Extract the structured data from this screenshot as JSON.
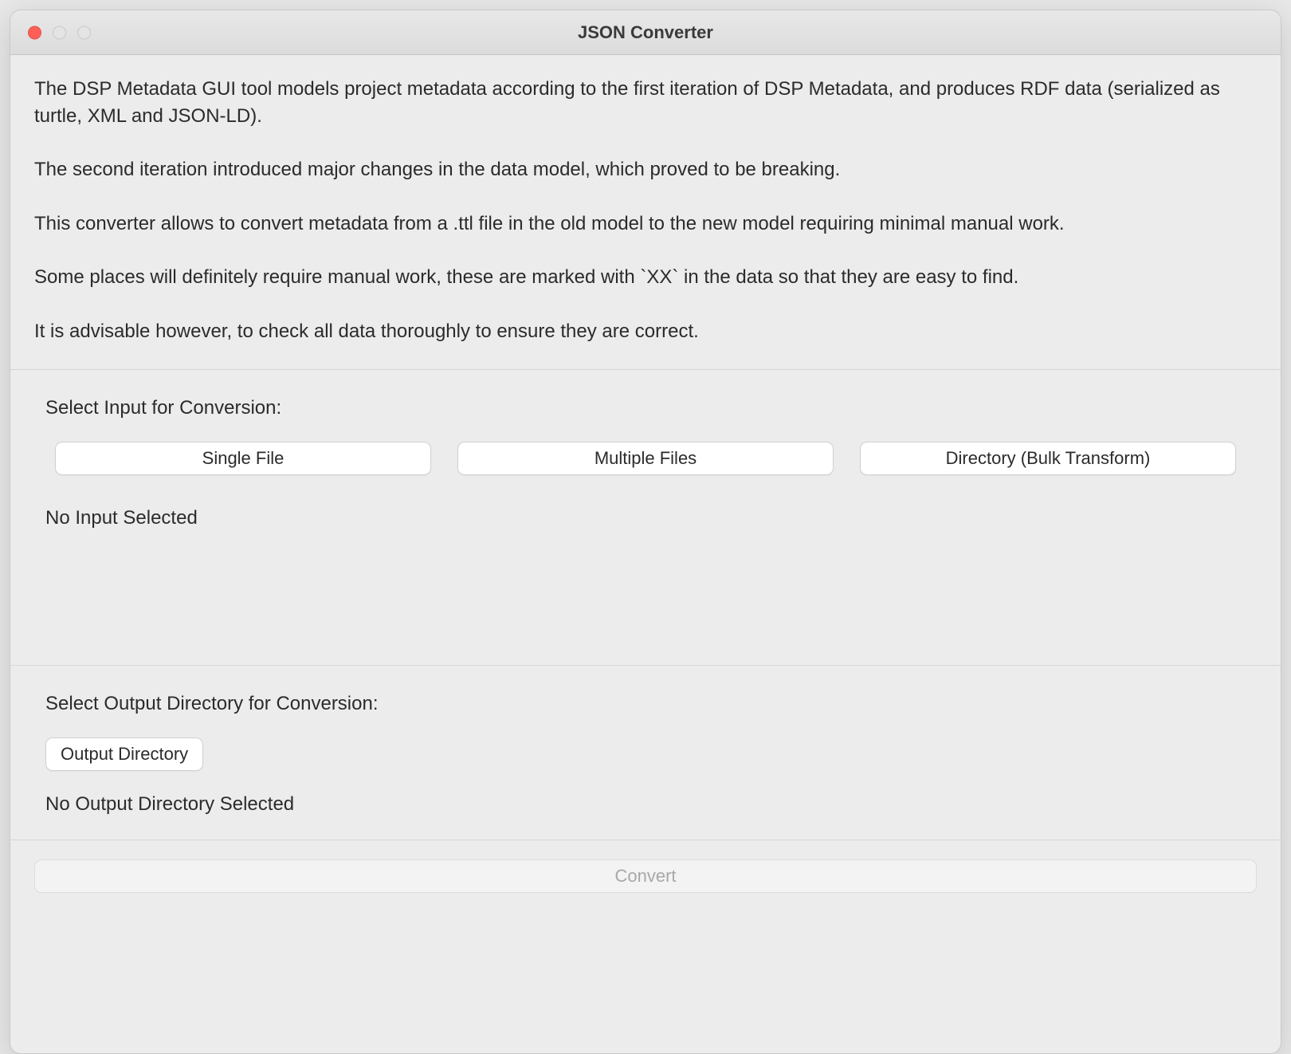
{
  "window": {
    "title": "JSON Converter"
  },
  "description": {
    "p1": "The DSP Metadata GUI tool models project metadata according to the first iteration of DSP Metadata, and produces RDF data (serialized as turtle, XML and JSON-LD).",
    "p2": "The second iteration introduced major changes in the data model, which proved to be breaking.",
    "p3": "This converter allows to convert metadata from a .ttl file in the old model to the new model requiring minimal manual work.",
    "p4": "Some places will definitely require manual work, these are marked with `XX` in the data so that they are easy to find.",
    "p5": "It is advisable however, to check all data thoroughly to ensure they are correct."
  },
  "input": {
    "label": "Select Input for Conversion:",
    "buttons": {
      "single": "Single File",
      "multiple": "Multiple Files",
      "directory": "Directory (Bulk Transform)"
    },
    "status": "No Input Selected"
  },
  "output": {
    "label": "Select Output Directory for Conversion:",
    "button": "Output Directory",
    "status": "No Output Directory Selected"
  },
  "convert": {
    "label": "Convert",
    "enabled": false
  }
}
